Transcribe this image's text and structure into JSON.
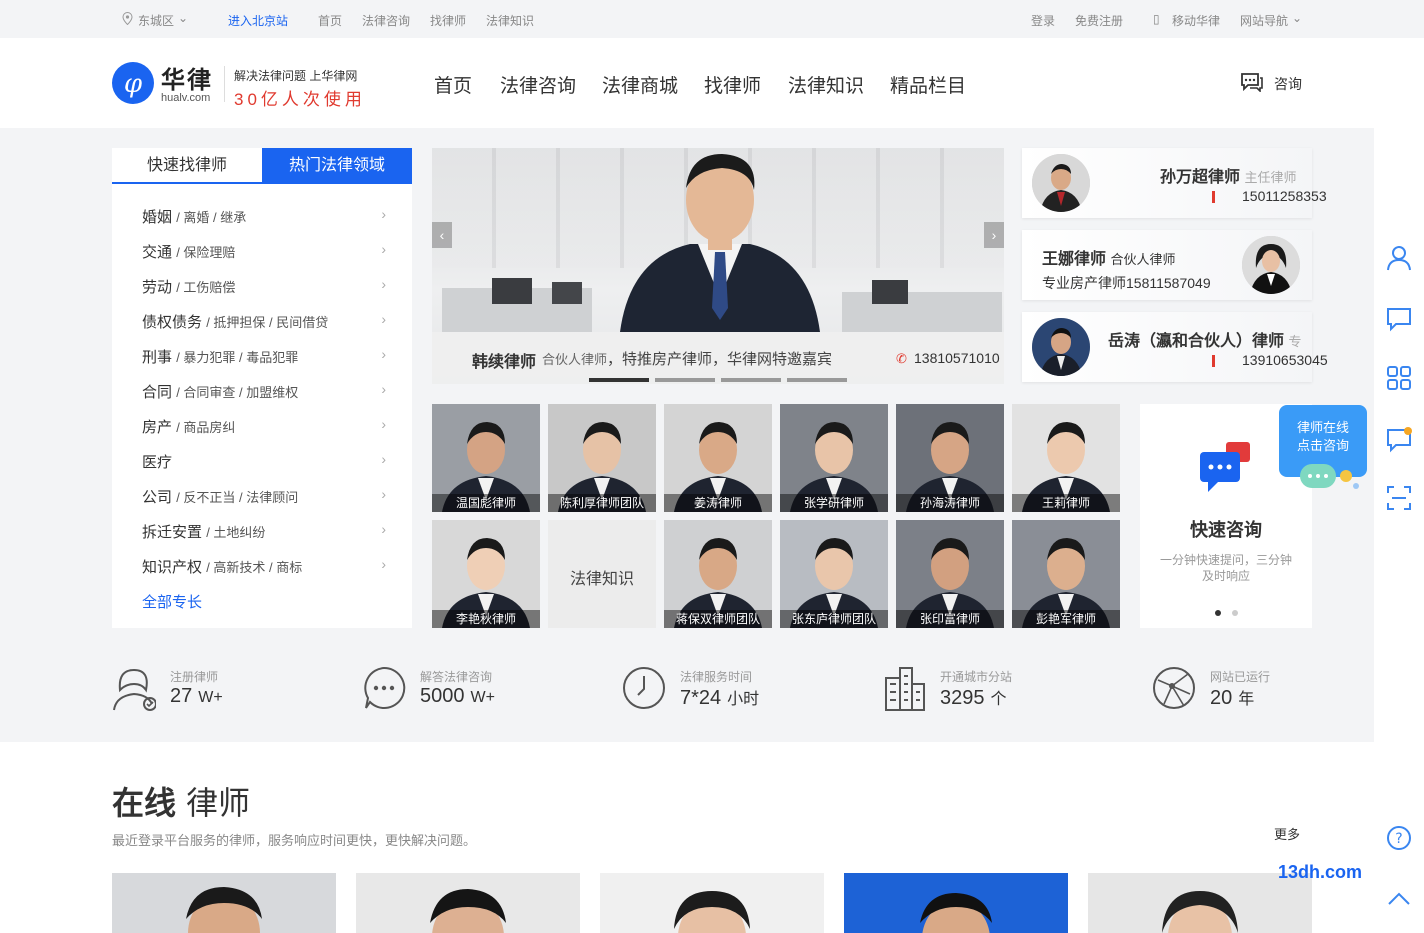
{
  "topbar": {
    "location": "东城区",
    "city_station": "进入北京站",
    "links": [
      "首页",
      "法律咨询",
      "找律师",
      "法律知识"
    ],
    "login": "登录",
    "register": "免费注册",
    "mobile": "移动华律",
    "site_nav": "网站导航"
  },
  "header": {
    "logo_name": "华律",
    "logo_domain": "hualv.com",
    "slogan_line1": "解决法律问题 上华律网",
    "slogan_line2": "30亿人次使用",
    "nav": [
      "首页",
      "法律咨询",
      "法律商城",
      "找律师",
      "法律知识",
      "精品栏目"
    ],
    "consult": "咨询"
  },
  "left_panel": {
    "tabs": [
      "快速找律师",
      "热门法律领域"
    ],
    "categories": [
      {
        "main": "婚姻",
        "subs": "/ 离婚 / 继承"
      },
      {
        "main": "交通",
        "subs": "/ 保险理赔"
      },
      {
        "main": "劳动",
        "subs": "/ 工伤赔偿"
      },
      {
        "main": "债权债务",
        "subs": "/ 抵押担保 / 民间借贷"
      },
      {
        "main": "刑事",
        "subs": "/ 暴力犯罪 / 毒品犯罪"
      },
      {
        "main": "合同",
        "subs": "/ 合同审查 / 加盟维权"
      },
      {
        "main": "房产",
        "subs": "/ 商品房纠"
      },
      {
        "main": "医疗",
        "subs": ""
      },
      {
        "main": "公司",
        "subs": "/ 反不正当 / 法律顾问"
      },
      {
        "main": "拆迁安置",
        "subs": "/ 土地纠纷"
      },
      {
        "main": "知识产权",
        "subs": "/ 高新技术 / 商标"
      }
    ],
    "all_label": "全部专长"
  },
  "banner": {
    "name": "韩续律师",
    "title": "合伙人律师",
    "desc": "，特推房产律师，华律网特邀嘉宾",
    "phone": "13810571010"
  },
  "right_cards": [
    {
      "name": "孙万超律师",
      "title": "主任律师",
      "phone": "15011258353"
    },
    {
      "name": "王娜律师",
      "title": "合伙人律师",
      "phone": "专业房产律师15811587049"
    },
    {
      "name": "岳涛（瀛和合伙人）律师",
      "title": "专",
      "phone": "13910653045"
    }
  ],
  "lawyer_tiles": [
    "温国彪律师",
    "陈利厚律师团队",
    "姜涛律师",
    "张学研律师",
    "孙海涛律师",
    "王莉律师",
    "李艳秋律师",
    "法律知识",
    "蒋保双律师团队",
    "张东庐律师团队",
    "张印富律师",
    "彭艳军律师"
  ],
  "quick_consult": {
    "title": "快速咨询",
    "desc": "一分钟快速提问，三分钟及时响应",
    "accent": "#1a64f0"
  },
  "stats": [
    {
      "label": "注册律师",
      "value": "27",
      "unit": "W+"
    },
    {
      "label": "解答法律咨询",
      "value": "5000",
      "unit": "W+"
    },
    {
      "label": "法律服务时间",
      "value": "7*24",
      "unit": "小时"
    },
    {
      "label": "开通城市分站",
      "value": "3295",
      "unit": "个"
    },
    {
      "label": "网站已运行",
      "value": "20",
      "unit": "年"
    }
  ],
  "online": {
    "title_bold": "在线",
    "title_rest": "律师",
    "subtitle": "最近登录平台服务的律师，服务响应时间更快，更快解决问题。",
    "more": "更多"
  },
  "side_bubble": {
    "line1": "律师在线",
    "line2": "点击咨询"
  },
  "watermark": "13dh.com"
}
